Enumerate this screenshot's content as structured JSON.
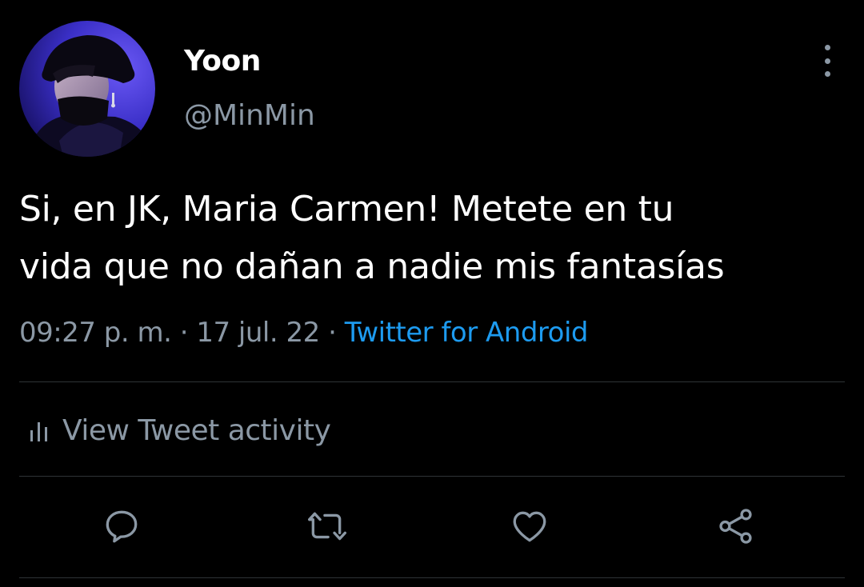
{
  "tweet": {
    "display_name": "Yoon",
    "handle": "@MinMin",
    "text_lines": [
      "Si, en JK, Maria Carmen! Metete en tu",
      "vida que no dañan a nadie mis fantasías"
    ],
    "time": "09:27 p. m.",
    "separator": "·",
    "date": "17 jul. 22",
    "source": "Twitter for Android"
  },
  "activity": {
    "label": "View Tweet activity",
    "icon": "bar-chart-icon"
  },
  "actions": [
    {
      "name": "reply",
      "icon": "reply-icon"
    },
    {
      "name": "retweet",
      "icon": "retweet-icon"
    },
    {
      "name": "like",
      "icon": "heart-icon"
    },
    {
      "name": "share",
      "icon": "share-icon"
    }
  ],
  "colors": {
    "background": "#000000",
    "primary_text": "#ffffff",
    "secondary_text": "#8b98a5",
    "link": "#1d9bf0",
    "divider": "#2f3336"
  }
}
